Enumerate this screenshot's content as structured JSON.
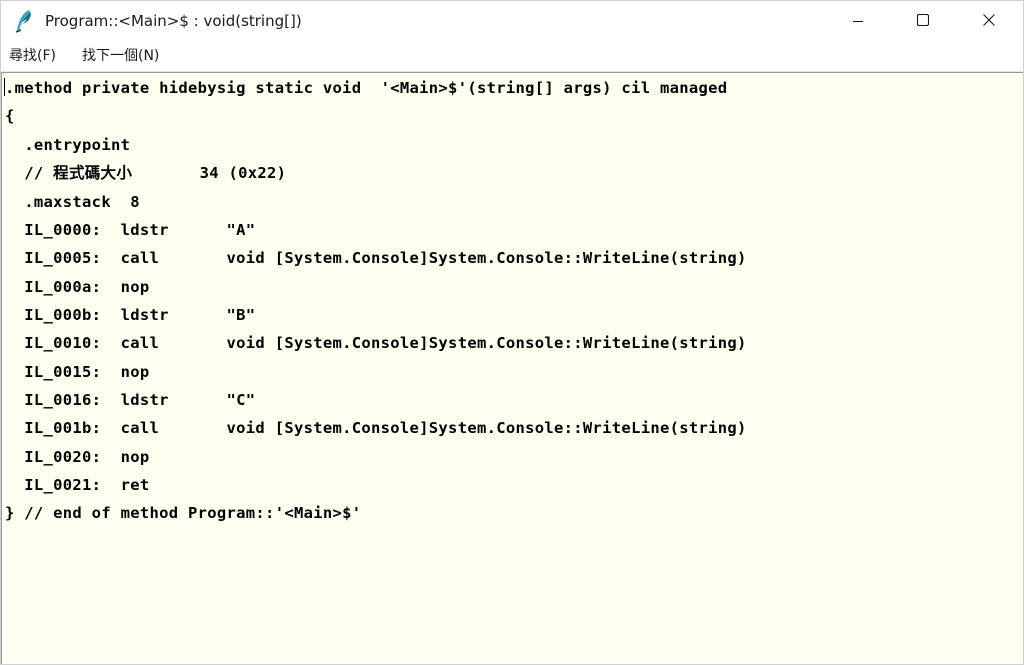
{
  "window": {
    "title": "Program::<Main>$ : void(string[])"
  },
  "icons": {
    "app": "ildasm-feather-icon",
    "minimize": "minimize-icon",
    "maximize": "maximize-icon",
    "close": "close-icon"
  },
  "menu": {
    "find_label": "尋找(F)",
    "find_next_label": "找下一個(N)"
  },
  "code": {
    "lines": [
      ".method private hidebysig static void  '<Main>$'(string[] args) cil managed",
      "{",
      "  .entrypoint",
      "  // 程式碼大小       34 (0x22)",
      "  .maxstack  8",
      "  IL_0000:  ldstr      \"A\"",
      "  IL_0005:  call       void [System.Console]System.Console::WriteLine(string)",
      "  IL_000a:  nop",
      "  IL_000b:  ldstr      \"B\"",
      "  IL_0010:  call       void [System.Console]System.Console::WriteLine(string)",
      "  IL_0015:  nop",
      "  IL_0016:  ldstr      \"C\"",
      "  IL_001b:  call       void [System.Console]System.Console::WriteLine(string)",
      "  IL_0020:  nop",
      "  IL_0021:  ret",
      "} // end of method Program::'<Main>$'"
    ]
  },
  "colors": {
    "editor_background": "#fffff0",
    "titlebar_background": "#ffffff",
    "text": "#000000"
  }
}
